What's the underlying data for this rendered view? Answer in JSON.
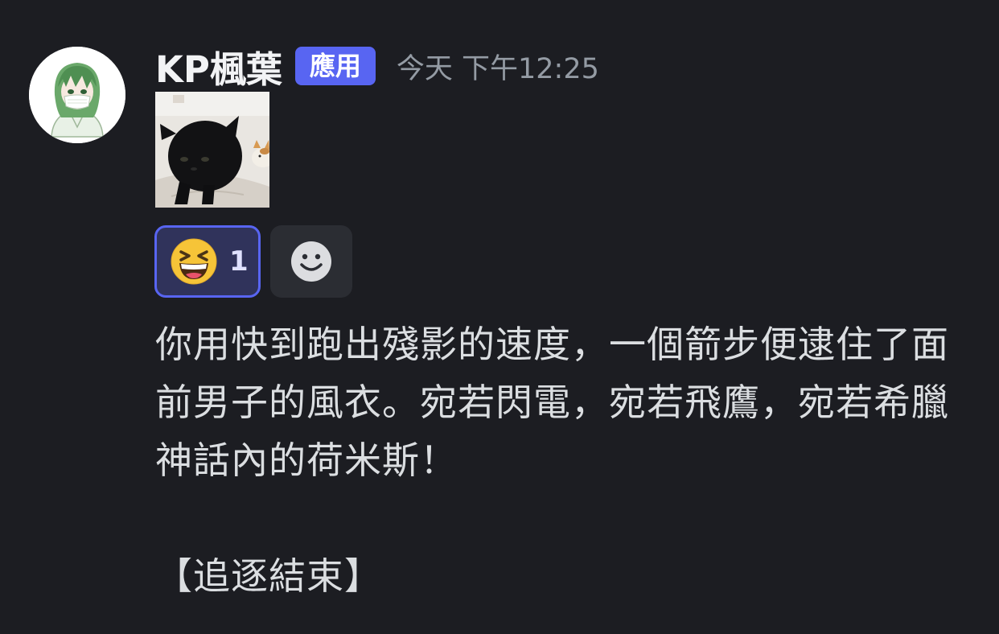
{
  "message": {
    "author": "KP楓葉",
    "badge": "應用",
    "timestamp": "今天 下午12:25",
    "avatar_icon": "anime-character-avatar",
    "attachment_icon": "black-cat-image",
    "reactions": [
      {
        "emoji": "laughing-squinting-face",
        "count": "1",
        "active": true
      }
    ],
    "add_reaction_icon": "smiley-add-reaction-icon",
    "content": "你用快到跑出殘影的速度，一個箭步便逮住了面前男子的風衣。宛若閃電，宛若飛鷹，宛若希臘神話內的荷米斯！\n\n【追逐結束】"
  },
  "colors": {
    "background": "#1c1d22",
    "badge": "#5865f2",
    "reaction_active_bg": "#30335b",
    "reaction_active_border": "#5865f2",
    "text": "#dbdee1",
    "muted": "#949ba4"
  }
}
